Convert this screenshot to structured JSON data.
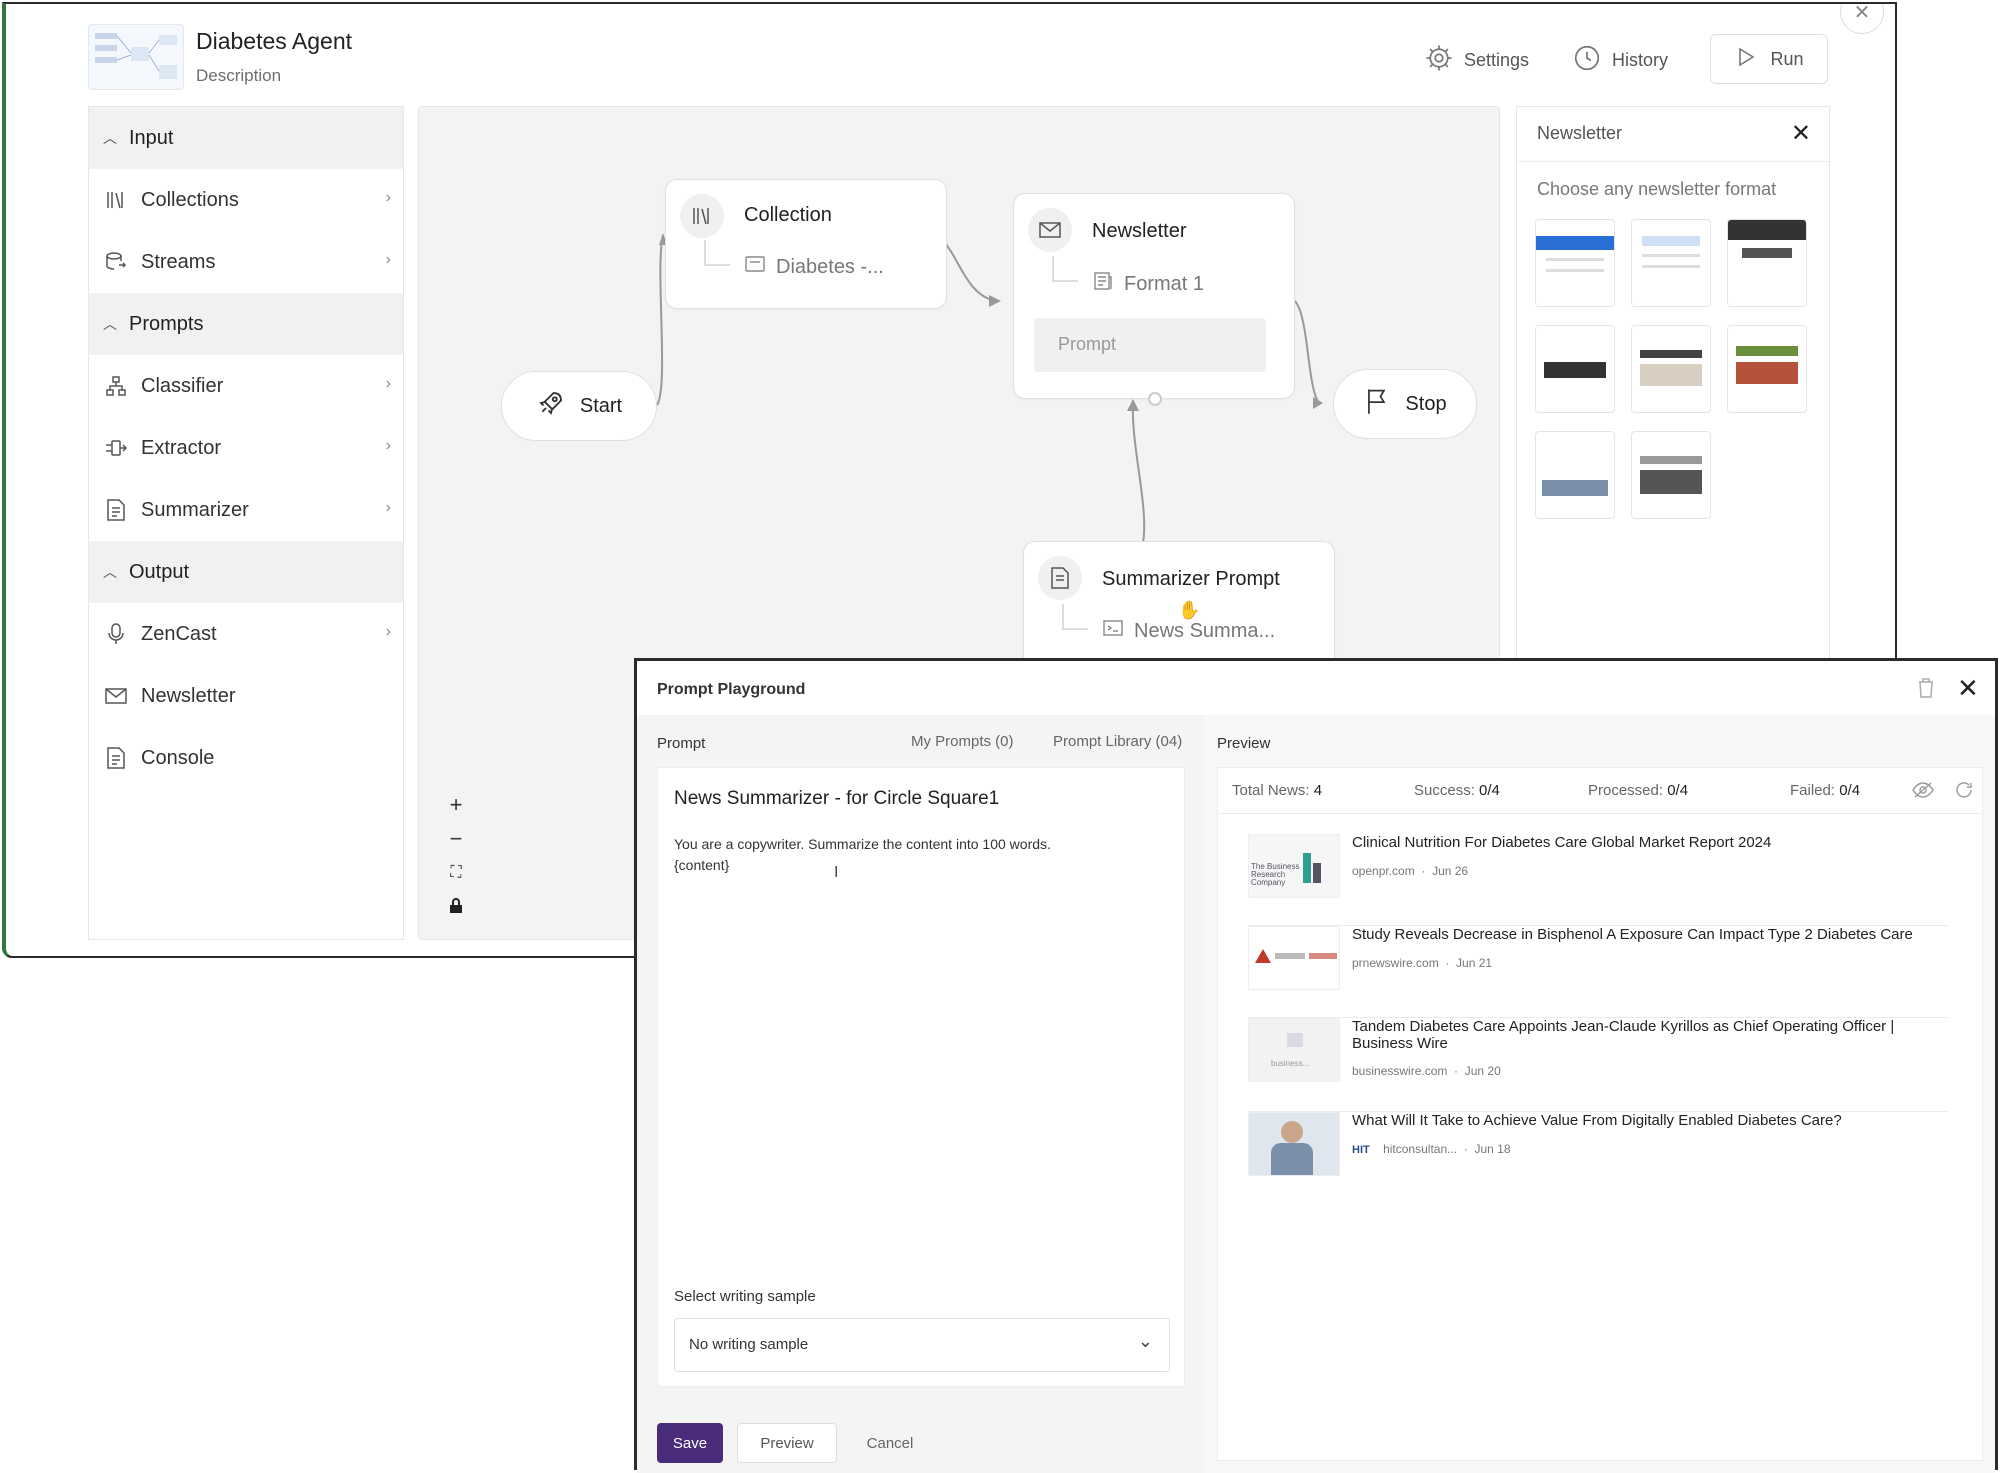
{
  "app": {
    "title": "Diabetes Agent",
    "description": "Description",
    "actions": {
      "settings": "Settings",
      "history": "History",
      "run": "Run"
    }
  },
  "sidebar": {
    "sections": [
      {
        "label": "Input",
        "items": [
          {
            "label": "Collections",
            "icon": "library-icon"
          },
          {
            "label": "Streams",
            "icon": "database-icon"
          }
        ]
      },
      {
        "label": "Prompts",
        "items": [
          {
            "label": "Classifier",
            "icon": "hierarchy-icon"
          },
          {
            "label": "Extractor",
            "icon": "extractor-icon"
          },
          {
            "label": "Summarizer",
            "icon": "document-icon"
          }
        ]
      },
      {
        "label": "Output",
        "items": [
          {
            "label": "ZenCast",
            "icon": "microphone-icon"
          },
          {
            "label": "Newsletter",
            "icon": "mail-icon"
          },
          {
            "label": "Console",
            "icon": "document-icon"
          }
        ]
      }
    ]
  },
  "canvas": {
    "nodes": {
      "start": "Start",
      "stop": "Stop",
      "collection": {
        "title": "Collection",
        "sub": "Diabetes -..."
      },
      "newsletter": {
        "title": "Newsletter",
        "sub": "Format 1",
        "prompt": "Prompt"
      },
      "summarizer": {
        "title": "Summarizer Prompt",
        "sub": "News Summa..."
      }
    },
    "zoom_controls": [
      "+",
      "−",
      "⛶",
      "🔒"
    ]
  },
  "newsletter_panel": {
    "title": "Newsletter",
    "subtitle": "Choose any newsletter format"
  },
  "playground": {
    "title": "Prompt Playground",
    "prompt_tab": "Prompt",
    "my_prompts": "My Prompts (0)",
    "prompt_library": "Prompt Library (04)",
    "prompt_title": "News Summarizer - for Circle Square1",
    "prompt_body": "You are a copywriter. Summarize the content into 100 words.\n{content}",
    "writing_sample_label": "Select writing sample",
    "writing_sample_value": "No writing sample",
    "buttons": {
      "save": "Save",
      "preview": "Preview",
      "cancel": "Cancel"
    },
    "preview": {
      "label": "Preview",
      "stats": {
        "total_label": "Total News:",
        "total": "4",
        "success_label": "Success:",
        "success": "0/4",
        "processed_label": "Processed:",
        "processed": "0/4",
        "failed_label": "Failed:",
        "failed": "0/4"
      },
      "news": [
        {
          "title": "Clinical Nutrition For Diabetes Care Global Market Report 2024",
          "source": "openpr.com",
          "date": "Jun 26",
          "thumb_text": "The Business Research Company"
        },
        {
          "title": "Study Reveals Decrease in Bisphenol A Exposure Can Impact Type 2 Diabetes Care",
          "source": "prnewswire.com",
          "date": "Jun 21",
          "thumb_text": ""
        },
        {
          "title": "Tandem Diabetes Care Appoints Jean-Claude Kyrillos as Chief Operating Officer | Business Wire",
          "source": "businesswire.com",
          "date": "Jun 20",
          "thumb_text": "business..."
        },
        {
          "title": "What Will It Take to Achieve Value From Digitally Enabled Diabetes Care?",
          "source": "hitconsultan...",
          "date": "Jun 18",
          "thumb_text": "",
          "source_logo": "HIT"
        }
      ]
    }
  },
  "colors": {
    "primary": "#4a2c7c",
    "canvas_bg": "#f2f3f4"
  }
}
